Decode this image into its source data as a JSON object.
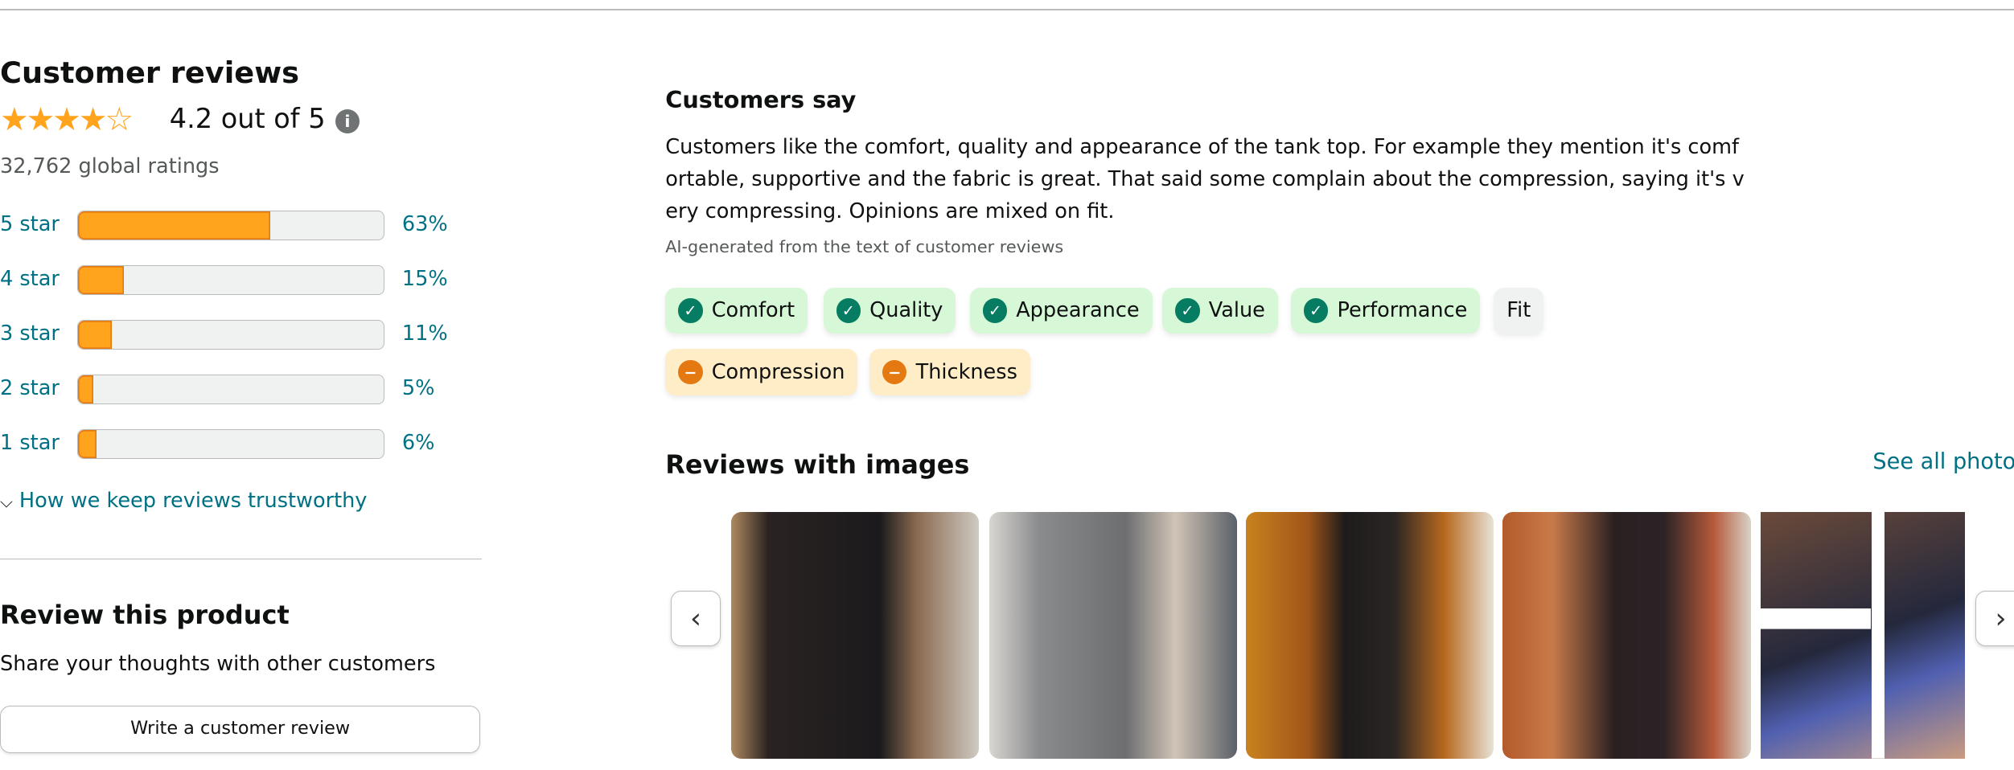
{
  "left": {
    "title": "Customer reviews",
    "rating": 4.2,
    "rating_text": "4.2 out of 5",
    "info_icon": "info-icon",
    "global_ratings": "32,762 global ratings",
    "histogram": [
      {
        "label": "5 star",
        "percent": 63,
        "percent_text": "63%"
      },
      {
        "label": "4 star",
        "percent": 15,
        "percent_text": "15%"
      },
      {
        "label": "3 star",
        "percent": 11,
        "percent_text": "11%"
      },
      {
        "label": "2 star",
        "percent": 5,
        "percent_text": "5%"
      },
      {
        "label": "1 star",
        "percent": 6,
        "percent_text": "6%"
      }
    ],
    "trust_link": "How we keep reviews trustworthy",
    "review_title": "Review this product",
    "review_subtitle": "Share your thoughts with other customers",
    "write_button": "Write a customer review"
  },
  "customers_say": {
    "title": "Customers say",
    "summary": "Customers like the comfort, quality and appearance of the tank top. For example they mention it's comfortable, supportive and the fabric is great. That said some complain about the compression, saying it's very compressing. Opinions are mixed on fit.",
    "ai_note": "AI-generated from the text of customer reviews",
    "chips": [
      {
        "label": "Comfort",
        "sentiment": "positive"
      },
      {
        "label": "Quality",
        "sentiment": "positive"
      },
      {
        "label": "Appearance",
        "sentiment": "positive"
      },
      {
        "label": "Value",
        "sentiment": "positive"
      },
      {
        "label": "Performance",
        "sentiment": "positive"
      },
      {
        "label": "Fit",
        "sentiment": "mixed"
      },
      {
        "label": "Compression",
        "sentiment": "negative"
      },
      {
        "label": "Thickness",
        "sentiment": "negative"
      }
    ]
  },
  "reviews_images": {
    "title": "Reviews with images",
    "see_all": "See all photos"
  },
  "colors": {
    "star": "#ffa41c",
    "link": "#007185",
    "positive": "#067d62",
    "negative": "#e47911"
  }
}
